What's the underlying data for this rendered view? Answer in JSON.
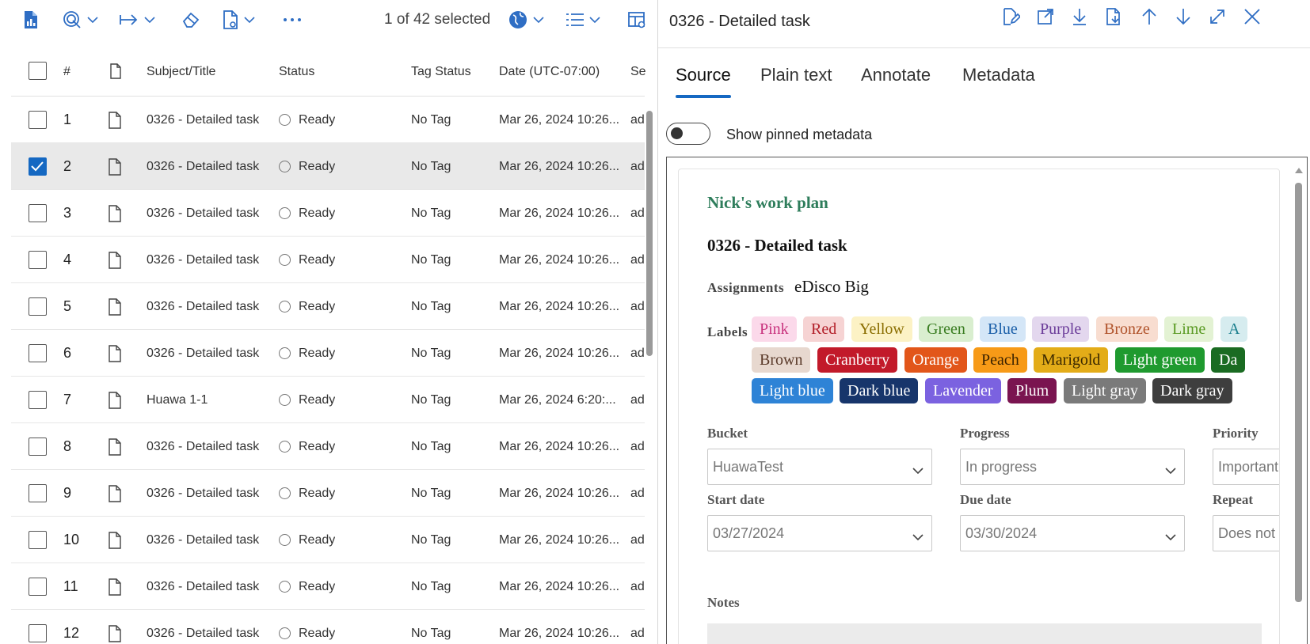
{
  "toolbar": {
    "selection_text": "1 of 42 selected",
    "accent": "#2f6ec4",
    "icons": [
      "report-icon",
      "tag-icon",
      "export-icon",
      "erase-icon",
      "document-icon",
      "more-icon",
      "globe-icon",
      "list-view-icon",
      "layout-icon"
    ]
  },
  "grid": {
    "headers": {
      "num": "#",
      "subject": "Subject/Title",
      "status": "Status",
      "tag_status": "Tag Status",
      "date": "Date (UTC-07:00)",
      "se": "Se"
    },
    "rows": [
      {
        "num": "1",
        "subject": "0326 - Detailed task",
        "status": "Ready",
        "tag": "No Tag",
        "date": "Mar 26, 2024 10:26...",
        "se": "ad",
        "selected": false
      },
      {
        "num": "2",
        "subject": "0326 - Detailed task",
        "status": "Ready",
        "tag": "No Tag",
        "date": "Mar 26, 2024 10:26...",
        "se": "ad",
        "selected": true
      },
      {
        "num": "3",
        "subject": "0326 - Detailed task",
        "status": "Ready",
        "tag": "No Tag",
        "date": "Mar 26, 2024 10:26...",
        "se": "ad",
        "selected": false
      },
      {
        "num": "4",
        "subject": "0326 - Detailed task",
        "status": "Ready",
        "tag": "No Tag",
        "date": "Mar 26, 2024 10:26...",
        "se": "ad",
        "selected": false
      },
      {
        "num": "5",
        "subject": "0326 - Detailed task",
        "status": "Ready",
        "tag": "No Tag",
        "date": "Mar 26, 2024 10:26...",
        "se": "ad",
        "selected": false
      },
      {
        "num": "6",
        "subject": "0326 - Detailed task",
        "status": "Ready",
        "tag": "No Tag",
        "date": "Mar 26, 2024 10:26...",
        "se": "ad",
        "selected": false
      },
      {
        "num": "7",
        "subject": "Huawa 1-1",
        "status": "Ready",
        "tag": "No Tag",
        "date": "Mar 26, 2024 6:20:...",
        "se": "ad",
        "selected": false
      },
      {
        "num": "8",
        "subject": "0326 - Detailed task",
        "status": "Ready",
        "tag": "No Tag",
        "date": "Mar 26, 2024 10:26...",
        "se": "ad",
        "selected": false
      },
      {
        "num": "9",
        "subject": "0326 - Detailed task",
        "status": "Ready",
        "tag": "No Tag",
        "date": "Mar 26, 2024 10:26...",
        "se": "ad",
        "selected": false
      },
      {
        "num": "10",
        "subject": "0326 - Detailed task",
        "status": "Ready",
        "tag": "No Tag",
        "date": "Mar 26, 2024 10:26...",
        "se": "ad",
        "selected": false
      },
      {
        "num": "11",
        "subject": "0326 - Detailed task",
        "status": "Ready",
        "tag": "No Tag",
        "date": "Mar 26, 2024 10:26...",
        "se": "ad",
        "selected": false
      },
      {
        "num": "12",
        "subject": "0326 - Detailed task",
        "status": "Ready",
        "tag": "No Tag",
        "date": "Mar 26, 2024 10:26...",
        "se": "ad",
        "selected": false
      }
    ]
  },
  "panel": {
    "title": "0326 - Detailed task",
    "header_icons": [
      "edit-icon",
      "open-external-icon",
      "download-icon",
      "save-document-icon",
      "previous-icon",
      "next-icon",
      "expand-icon",
      "close-icon"
    ],
    "tabs": [
      "Source",
      "Plain text",
      "Annotate",
      "Metadata"
    ],
    "active_tab": "Source",
    "toggle_label": "Show pinned metadata",
    "toggle_on": false
  },
  "preview": {
    "plan_title": "Nick's work plan",
    "task_title": "0326 - Detailed task",
    "assignments_label": "Assignments",
    "assignments_value": "eDisco Big",
    "labels_label": "Labels",
    "labels": [
      {
        "text": "Pink",
        "bg": "#fbd9ea",
        "fg": "#c8337e"
      },
      {
        "text": "Red",
        "bg": "#f6d3d3",
        "fg": "#b3202a"
      },
      {
        "text": "Yellow",
        "bg": "#fcf2c5",
        "fg": "#8a6d00"
      },
      {
        "text": "Green",
        "bg": "#d9eecf",
        "fg": "#3a7d22"
      },
      {
        "text": "Blue",
        "bg": "#d4e6f7",
        "fg": "#1a5ea8"
      },
      {
        "text": "Purple",
        "bg": "#e3d7ee",
        "fg": "#6c3d9a"
      },
      {
        "text": "Bronze",
        "bg": "#f8ddd0",
        "fg": "#b0532b"
      },
      {
        "text": "Lime",
        "bg": "#e3f2d3",
        "fg": "#5a9a23"
      },
      {
        "text": "A",
        "bg": "#d6ecef",
        "fg": "#1b7f8e"
      },
      {
        "text": "Brown",
        "bg": "#e7d8cf",
        "fg": "#5a3a2a"
      },
      {
        "text": "Cranberry",
        "bg": "#c21a2a",
        "fg": "#ffffff"
      },
      {
        "text": "Orange",
        "bg": "#e2561a",
        "fg": "#ffffff"
      },
      {
        "text": "Peach",
        "bg": "#f79a17",
        "fg": "#3a2200"
      },
      {
        "text": "Marigold",
        "bg": "#e3ac18",
        "fg": "#3a2800"
      },
      {
        "text": "Light green",
        "bg": "#1f9a2f",
        "fg": "#ffffff"
      },
      {
        "text": "Da",
        "bg": "#1a6b22",
        "fg": "#ffffff"
      },
      {
        "text": "Light blue",
        "bg": "#2e83d6",
        "fg": "#ffffff"
      },
      {
        "text": "Dark blue",
        "bg": "#17356b",
        "fg": "#ffffff"
      },
      {
        "text": "Lavender",
        "bg": "#7b62e0",
        "fg": "#ffffff"
      },
      {
        "text": "Plum",
        "bg": "#7a1450",
        "fg": "#ffffff"
      },
      {
        "text": "Light gray",
        "bg": "#7a7a7a",
        "fg": "#ffffff"
      },
      {
        "text": "Dark gray",
        "bg": "#3e3e3e",
        "fg": "#ffffff"
      }
    ],
    "fields": {
      "bucket_label": "Bucket",
      "bucket_value": "HuawaTest",
      "progress_label": "Progress",
      "progress_value": "In progress",
      "priority_label": "Priority",
      "priority_value": "Important",
      "start_label": "Start date",
      "start_value": "03/27/2024",
      "due_label": "Due date",
      "due_value": "03/30/2024",
      "repeat_label": "Repeat",
      "repeat_value": "Does not re"
    },
    "notes_label": "Notes"
  }
}
